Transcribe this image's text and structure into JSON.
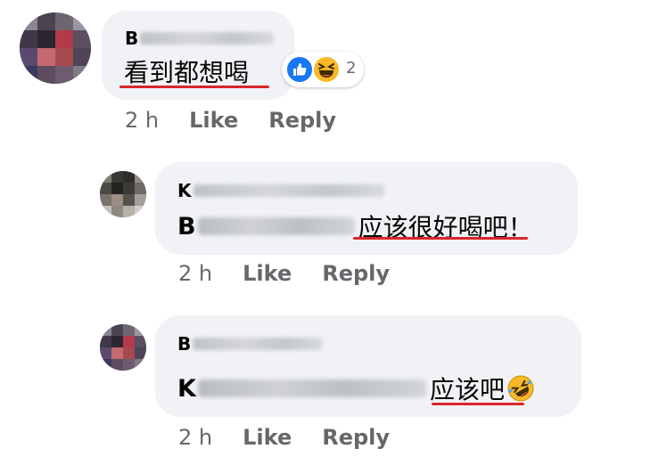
{
  "comments": [
    {
      "author_initial": "B",
      "text": "看到都想喝",
      "reactions": {
        "icons": [
          "like-icon",
          "haha-icon"
        ],
        "count": "2"
      },
      "time": "2 h",
      "like_label": "Like",
      "reply_label": "Reply"
    },
    {
      "author_initial": "K",
      "mention_initial": "B",
      "text": "应该很好喝吧！",
      "time": "2 h",
      "like_label": "Like",
      "reply_label": "Reply"
    },
    {
      "author_initial": "B",
      "mention_initial": "K",
      "text": "应该吧",
      "emoji": "rolling-on-floor-laughing-emoji",
      "time": "2 h",
      "like_label": "Like",
      "reply_label": "Reply"
    }
  ],
  "colors": {
    "bubble": "#f0f2f5",
    "meta_text": "#65676b",
    "underline": "#d9262b",
    "like_blue": "#1877f2",
    "haha_yellow": "#f7b928"
  }
}
